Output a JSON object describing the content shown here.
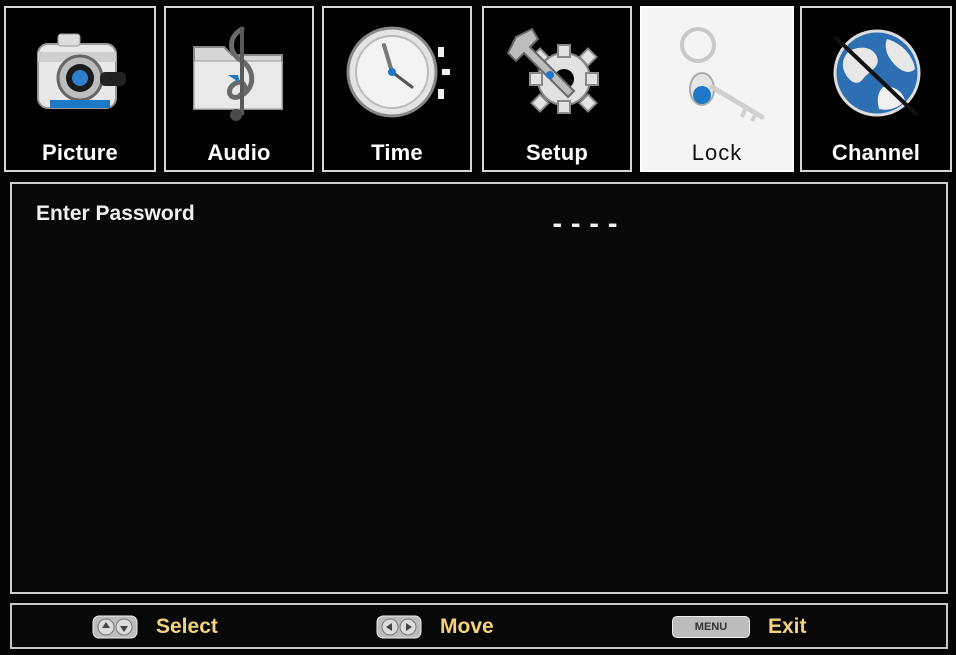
{
  "tabs": [
    {
      "id": "picture",
      "label": "Picture",
      "active": false
    },
    {
      "id": "audio",
      "label": "Audio",
      "active": false
    },
    {
      "id": "time",
      "label": "Time",
      "active": false
    },
    {
      "id": "setup",
      "label": "Setup",
      "active": false
    },
    {
      "id": "lock",
      "label": "Lock",
      "active": true
    },
    {
      "id": "channel",
      "label": "Channel",
      "active": false
    }
  ],
  "panel": {
    "password_label": "Enter Password",
    "password_value": "----"
  },
  "help": {
    "select_label": "Select",
    "move_label": "Move",
    "menu_key": "MENU",
    "exit_label": "Exit"
  },
  "colors": {
    "help_text": "#f3d27a",
    "accent_blue": "#1e78c8",
    "active_tab_bg": "#f4f4f4"
  }
}
